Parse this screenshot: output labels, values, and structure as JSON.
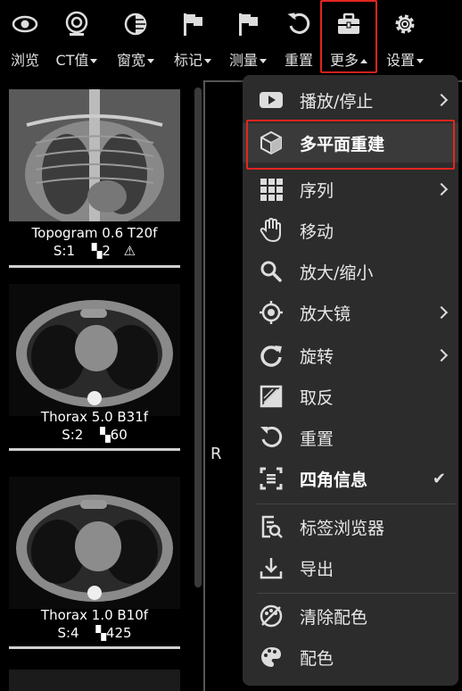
{
  "toolbar": {
    "items": [
      {
        "label": "浏览",
        "icon": "eye-icon",
        "caret": false
      },
      {
        "label": "CT值",
        "icon": "ct-value-icon",
        "caret": true
      },
      {
        "label": "窗宽",
        "icon": "window-width-icon",
        "caret": true
      },
      {
        "label": "标记",
        "icon": "flag-icon",
        "caret": true
      },
      {
        "label": "测量",
        "icon": "measure-flag-icon",
        "caret": true
      },
      {
        "label": "重置",
        "icon": "reset-icon",
        "caret": false
      },
      {
        "label": "更多",
        "icon": "toolbox-icon",
        "caret": true
      },
      {
        "label": "设置",
        "icon": "gear-icon",
        "caret": true
      }
    ]
  },
  "series": [
    {
      "title": "Topogram 0.6 T20f",
      "series_no": "S:1",
      "count": "2",
      "warning": true
    },
    {
      "title": "Thorax 5.0 B31f",
      "series_no": "S:2",
      "count": "60",
      "warning": false
    },
    {
      "title": "Thorax 1.0 B10f",
      "series_no": "S:4",
      "count": "425",
      "warning": false
    }
  ],
  "viewer": {
    "orientation_marker": "R"
  },
  "menu": {
    "items": [
      {
        "label": "播放/停止",
        "icon": "play-icon",
        "submenu": true
      },
      {
        "label": "多平面重建",
        "icon": "cube-icon",
        "highlighted": true
      },
      {
        "label": "序列",
        "icon": "grid-icon",
        "submenu": true
      },
      {
        "label": "移动",
        "icon": "hand-icon"
      },
      {
        "label": "放大/缩小",
        "icon": "magnifier-icon"
      },
      {
        "label": "放大镜",
        "icon": "target-icon",
        "submenu": true
      },
      {
        "label": "旋转",
        "icon": "rotate-icon",
        "submenu": true
      },
      {
        "label": "取反",
        "icon": "invert-icon"
      },
      {
        "label": "重置",
        "icon": "reset-icon"
      },
      {
        "label": "四角信息",
        "icon": "corner-info-icon",
        "checked": true
      },
      {
        "label": "标签浏览器",
        "icon": "tag-browser-icon"
      },
      {
        "label": "导出",
        "icon": "export-icon"
      },
      {
        "label": "清除配色",
        "icon": "clear-palette-icon"
      },
      {
        "label": "配色",
        "icon": "palette-icon"
      }
    ],
    "checkmark": "✔"
  },
  "colors": {
    "highlight": "#e3261f",
    "menu_bg": "#2c2c2c"
  }
}
